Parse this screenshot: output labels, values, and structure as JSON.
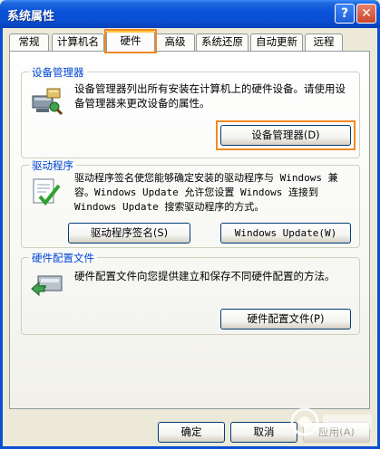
{
  "window": {
    "title": "系统属性"
  },
  "titlebar": {
    "help_icon": "?",
    "close_icon": "✕"
  },
  "tabs": [
    {
      "label": "常规"
    },
    {
      "label": "计算机名"
    },
    {
      "label": "硬件",
      "active": true
    },
    {
      "label": "高级"
    },
    {
      "label": "系统还原"
    },
    {
      "label": "自动更新"
    },
    {
      "label": "远程"
    }
  ],
  "device_manager": {
    "title": "设备管理器",
    "description": "设备管理器列出所有安装在计算机上的硬件设备。请使用设备管理器来更改设备的属性。",
    "button": "设备管理器(D)",
    "icon": "device-manager-icon"
  },
  "driver": {
    "title": "驱动程序",
    "description": "驱动程序签名使您能够确定安装的驱动程序与 Windows 兼容。Windows Update 允许您设置 Windows 连接到 Windows Update 搜索驱动程序的方式。",
    "signing_button": "驱动程序签名(S)",
    "update_button": "Windows Update(W)",
    "icon": "driver-signing-icon"
  },
  "hardware_profiles": {
    "title": "硬件配置文件",
    "description": "硬件配置文件向您提供建立和保存不同硬件配置的方法。",
    "button": "硬件配置文件(P)",
    "icon": "hardware-profile-icon"
  },
  "footer": {
    "ok": "确定",
    "cancel": "取消",
    "apply": "应用(A)"
  },
  "colors": {
    "highlight": "#F08A24",
    "group_title": "#0046D5",
    "titlebar": "#0A52D8"
  }
}
